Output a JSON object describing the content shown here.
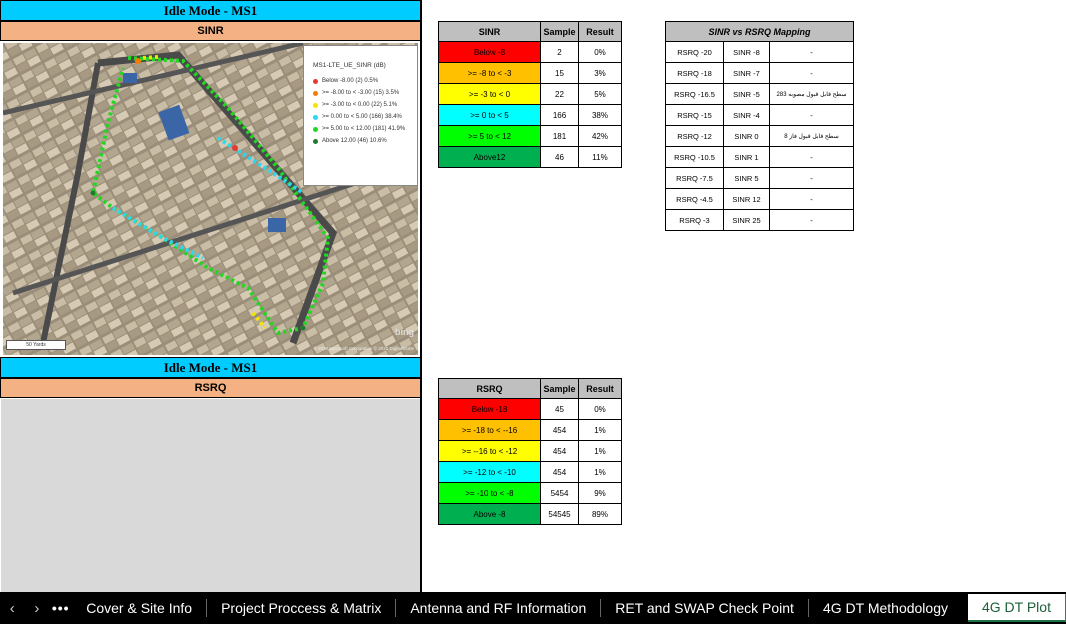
{
  "top_panel": {
    "title": "Idle Mode - MS1",
    "subtitle": "SINR"
  },
  "bottom_panel": {
    "title": "Idle Mode - MS1",
    "subtitle": "RSRQ"
  },
  "map": {
    "legend_title": "MS1-LTE_UE_SINR (dB)",
    "legend_items": [
      {
        "label": "Below -8.00 (2) 0.5%",
        "color": "#e53935"
      },
      {
        "label": ">= -8.00 to < -3.00 (15) 3.5%",
        "color": "#f57c00"
      },
      {
        "label": ">= -3.00 to < 0.00 (22) 5.1%",
        "color": "#f2e600"
      },
      {
        "label": ">= 0.00 to < 5.00 (166) 38.4%",
        "color": "#29d9f0"
      },
      {
        "label": ">= 5.00 to < 12.00 (181) 41.9%",
        "color": "#22d622"
      },
      {
        "label": "Above 12.00 (46) 10.6%",
        "color": "#1f7a2e"
      }
    ],
    "brand": "bing",
    "scale_label": "50 Yards",
    "copyright": "© 2020 Microsoft Corporation © 2020 DigitalGlobe"
  },
  "sinr_table": {
    "headers": [
      "SINR",
      "Sample",
      "Result"
    ],
    "rows": [
      {
        "label": "Below -8",
        "sample": "2",
        "result": "0%",
        "color": "#ff0000"
      },
      {
        "label": ">= -8 to < -3",
        "sample": "15",
        "result": "3%",
        "color": "#ffc000"
      },
      {
        "label": ">= -3 to < 0",
        "sample": "22",
        "result": "5%",
        "color": "#ffff00"
      },
      {
        "label": ">= 0 to < 5",
        "sample": "166",
        "result": "38%",
        "color": "#00ffff"
      },
      {
        "label": ">= 5 to < 12",
        "sample": "181",
        "result": "42%",
        "color": "#00ff00"
      },
      {
        "label": "Above12",
        "sample": "46",
        "result": "11%",
        "color": "#00b050"
      }
    ]
  },
  "rsrq_table": {
    "headers": [
      "RSRQ",
      "Sample",
      "Result"
    ],
    "rows": [
      {
        "label": "Below -18",
        "sample": "45",
        "result": "0%",
        "color": "#ff0000"
      },
      {
        "label": ">= -18 to < --16",
        "sample": "454",
        "result": "1%",
        "color": "#ffc000"
      },
      {
        "label": ">= --16 to < -12",
        "sample": "454",
        "result": "1%",
        "color": "#ffff00"
      },
      {
        "label": ">= -12 to < -10",
        "sample": "454",
        "result": "1%",
        "color": "#00ffff"
      },
      {
        "label": ">= -10 to < -8",
        "sample": "5454",
        "result": "9%",
        "color": "#00ff00"
      },
      {
        "label": "Above -8",
        "sample": "54545",
        "result": "89%",
        "color": "#00b050"
      }
    ]
  },
  "mapping_table": {
    "title": "SINR vs RSRQ Mapping",
    "rows": [
      {
        "rsrq": "RSRQ -20",
        "sinr": "SINR -8",
        "note": "-"
      },
      {
        "rsrq": "RSRQ -18",
        "sinr": "SINR -7",
        "note": "-"
      },
      {
        "rsrq": "RSRQ -16.5",
        "sinr": "SINR -5",
        "note": "سطح قابل قبول مصوبه 283"
      },
      {
        "rsrq": "RSRQ -15",
        "sinr": "SINR -4",
        "note": "-"
      },
      {
        "rsrq": "RSRQ -12",
        "sinr": "SINR 0",
        "note": "سطح قابل قبول فاز 8"
      },
      {
        "rsrq": "RSRQ -10.5",
        "sinr": "SINR 1",
        "note": "-"
      },
      {
        "rsrq": "RSRQ -7.5",
        "sinr": "SINR 5",
        "note": "-"
      },
      {
        "rsrq": "RSRQ -4.5",
        "sinr": "SINR 12",
        "note": "-"
      },
      {
        "rsrq": "RSRQ -3",
        "sinr": "SINR 25",
        "note": "-"
      }
    ]
  },
  "tabs": {
    "prev_icon": "chevron-left-icon",
    "next_icon": "chevron-right-icon",
    "more_icon": "more-icon",
    "more_label": "•••",
    "prev_label": "‹",
    "next_label": "›",
    "items": [
      {
        "label": "Cover & Site Info"
      },
      {
        "label": "Project Proccess & Matrix"
      },
      {
        "label": "Antenna and RF Information"
      },
      {
        "label": "RET and SWAP Check Point"
      },
      {
        "label": "4G DT Methodology"
      },
      {
        "label": "4G DT Plot"
      }
    ],
    "active_index": 5
  }
}
